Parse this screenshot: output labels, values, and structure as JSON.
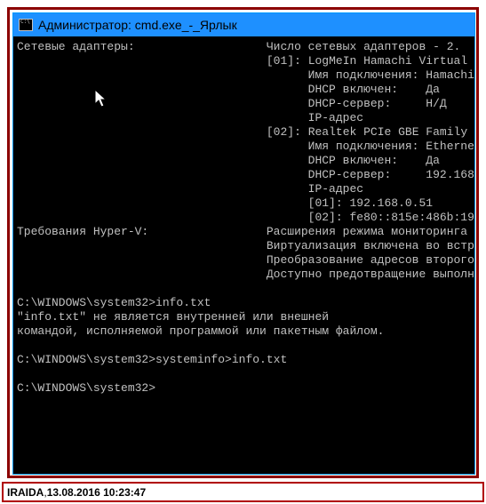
{
  "window": {
    "title": "Администратор: cmd.exe_-_Ярлык"
  },
  "terminal": {
    "label_adapters": "Сетевые адаптеры:",
    "adapter_count": "Число сетевых адаптеров - 2.",
    "a01_tag": "[01]:",
    "a01_name": "LogMeIn Hamachi Virtual ",
    "a01_conn_lbl": "Имя подключения:",
    "a01_conn_val": "Hamachi",
    "a01_dhcp_lbl": "DHCP включен:",
    "a01_dhcp_val": "Да",
    "a01_srv_lbl": "DHCP-сервер:",
    "a01_srv_val": "Н/Д",
    "a01_ip_lbl": "IP-адрес",
    "a02_tag": "[02]:",
    "a02_name": "Realtek PCIe GBE Family ",
    "a02_conn_lbl": "Имя подключения:",
    "a02_conn_val": "Etherne",
    "a02_dhcp_lbl": "DHCP включен:",
    "a02_dhcp_val": "Да",
    "a02_srv_lbl": "DHCP-сервер:",
    "a02_srv_val": "192.168",
    "a02_ip_lbl": "IP-адрес",
    "a02_ip1": "[01]: 192.168.0.51",
    "a02_ip2": "[02]: fe80::815e:486b:19",
    "label_hyperv": "Требования Hyper-V:",
    "hv1": "Расширения режима мониторинга",
    "hv2": "Виртуализация включена во встр",
    "hv3": "Преобразование адресов второго",
    "hv4": "Доступно предотвращение выполн",
    "prompt1": "C:\\WINDOWS\\system32>info.txt",
    "err1": "\"info.txt\" не является внутренней или внешней",
    "err2": "командой, исполняемой программой или пакетным файлом.",
    "prompt2": "C:\\WINDOWS\\system32>systeminfo>info.txt",
    "prompt3": "C:\\WINDOWS\\system32>"
  },
  "caption": {
    "author": "IRAIDA",
    "sep": "  ,  ",
    "timestamp": "13.08.2016 10:23:47"
  }
}
